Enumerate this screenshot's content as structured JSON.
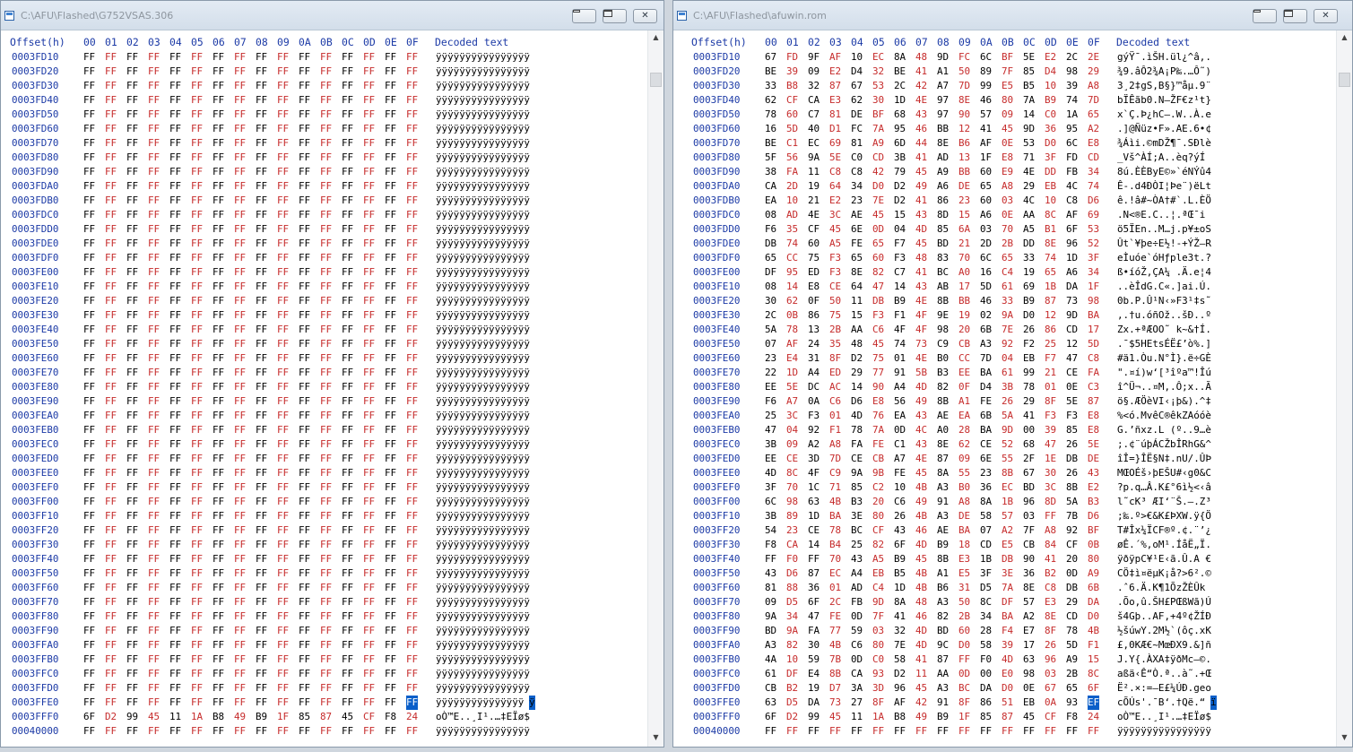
{
  "left": {
    "title": "C:\\AFU\\Flashed\\G752VSAS.306",
    "header": {
      "offset": "Offset(h)",
      "cols": [
        "00",
        "01",
        "02",
        "03",
        "04",
        "05",
        "06",
        "07",
        "08",
        "09",
        "0A",
        "0B",
        "0C",
        "0D",
        "0E",
        "0F"
      ],
      "decoded": "Decoded text"
    },
    "rows": [
      {
        "o": "0003FD10",
        "b": "FF FF FF FF FF FF FF FF FF FF FF FF FF FF FF FF",
        "d": "ÿÿÿÿÿÿÿÿÿÿÿÿÿÿÿÿ"
      },
      {
        "o": "0003FD20",
        "b": "FF FF FF FF FF FF FF FF FF FF FF FF FF FF FF FF",
        "d": "ÿÿÿÿÿÿÿÿÿÿÿÿÿÿÿÿ"
      },
      {
        "o": "0003FD30",
        "b": "FF FF FF FF FF FF FF FF FF FF FF FF FF FF FF FF",
        "d": "ÿÿÿÿÿÿÿÿÿÿÿÿÿÿÿÿ"
      },
      {
        "o": "0003FD40",
        "b": "FF FF FF FF FF FF FF FF FF FF FF FF FF FF FF FF",
        "d": "ÿÿÿÿÿÿÿÿÿÿÿÿÿÿÿÿ"
      },
      {
        "o": "0003FD50",
        "b": "FF FF FF FF FF FF FF FF FF FF FF FF FF FF FF FF",
        "d": "ÿÿÿÿÿÿÿÿÿÿÿÿÿÿÿÿ"
      },
      {
        "o": "0003FD60",
        "b": "FF FF FF FF FF FF FF FF FF FF FF FF FF FF FF FF",
        "d": "ÿÿÿÿÿÿÿÿÿÿÿÿÿÿÿÿ"
      },
      {
        "o": "0003FD70",
        "b": "FF FF FF FF FF FF FF FF FF FF FF FF FF FF FF FF",
        "d": "ÿÿÿÿÿÿÿÿÿÿÿÿÿÿÿÿ"
      },
      {
        "o": "0003FD80",
        "b": "FF FF FF FF FF FF FF FF FF FF FF FF FF FF FF FF",
        "d": "ÿÿÿÿÿÿÿÿÿÿÿÿÿÿÿÿ"
      },
      {
        "o": "0003FD90",
        "b": "FF FF FF FF FF FF FF FF FF FF FF FF FF FF FF FF",
        "d": "ÿÿÿÿÿÿÿÿÿÿÿÿÿÿÿÿ"
      },
      {
        "o": "0003FDA0",
        "b": "FF FF FF FF FF FF FF FF FF FF FF FF FF FF FF FF",
        "d": "ÿÿÿÿÿÿÿÿÿÿÿÿÿÿÿÿ"
      },
      {
        "o": "0003FDB0",
        "b": "FF FF FF FF FF FF FF FF FF FF FF FF FF FF FF FF",
        "d": "ÿÿÿÿÿÿÿÿÿÿÿÿÿÿÿÿ"
      },
      {
        "o": "0003FDC0",
        "b": "FF FF FF FF FF FF FF FF FF FF FF FF FF FF FF FF",
        "d": "ÿÿÿÿÿÿÿÿÿÿÿÿÿÿÿÿ"
      },
      {
        "o": "0003FDD0",
        "b": "FF FF FF FF FF FF FF FF FF FF FF FF FF FF FF FF",
        "d": "ÿÿÿÿÿÿÿÿÿÿÿÿÿÿÿÿ"
      },
      {
        "o": "0003FDE0",
        "b": "FF FF FF FF FF FF FF FF FF FF FF FF FF FF FF FF",
        "d": "ÿÿÿÿÿÿÿÿÿÿÿÿÿÿÿÿ"
      },
      {
        "o": "0003FDF0",
        "b": "FF FF FF FF FF FF FF FF FF FF FF FF FF FF FF FF",
        "d": "ÿÿÿÿÿÿÿÿÿÿÿÿÿÿÿÿ"
      },
      {
        "o": "0003FE00",
        "b": "FF FF FF FF FF FF FF FF FF FF FF FF FF FF FF FF",
        "d": "ÿÿÿÿÿÿÿÿÿÿÿÿÿÿÿÿ"
      },
      {
        "o": "0003FE10",
        "b": "FF FF FF FF FF FF FF FF FF FF FF FF FF FF FF FF",
        "d": "ÿÿÿÿÿÿÿÿÿÿÿÿÿÿÿÿ"
      },
      {
        "o": "0003FE20",
        "b": "FF FF FF FF FF FF FF FF FF FF FF FF FF FF FF FF",
        "d": "ÿÿÿÿÿÿÿÿÿÿÿÿÿÿÿÿ"
      },
      {
        "o": "0003FE30",
        "b": "FF FF FF FF FF FF FF FF FF FF FF FF FF FF FF FF",
        "d": "ÿÿÿÿÿÿÿÿÿÿÿÿÿÿÿÿ"
      },
      {
        "o": "0003FE40",
        "b": "FF FF FF FF FF FF FF FF FF FF FF FF FF FF FF FF",
        "d": "ÿÿÿÿÿÿÿÿÿÿÿÿÿÿÿÿ"
      },
      {
        "o": "0003FE50",
        "b": "FF FF FF FF FF FF FF FF FF FF FF FF FF FF FF FF",
        "d": "ÿÿÿÿÿÿÿÿÿÿÿÿÿÿÿÿ"
      },
      {
        "o": "0003FE60",
        "b": "FF FF FF FF FF FF FF FF FF FF FF FF FF FF FF FF",
        "d": "ÿÿÿÿÿÿÿÿÿÿÿÿÿÿÿÿ"
      },
      {
        "o": "0003FE70",
        "b": "FF FF FF FF FF FF FF FF FF FF FF FF FF FF FF FF",
        "d": "ÿÿÿÿÿÿÿÿÿÿÿÿÿÿÿÿ"
      },
      {
        "o": "0003FE80",
        "b": "FF FF FF FF FF FF FF FF FF FF FF FF FF FF FF FF",
        "d": "ÿÿÿÿÿÿÿÿÿÿÿÿÿÿÿÿ"
      },
      {
        "o": "0003FE90",
        "b": "FF FF FF FF FF FF FF FF FF FF FF FF FF FF FF FF",
        "d": "ÿÿÿÿÿÿÿÿÿÿÿÿÿÿÿÿ"
      },
      {
        "o": "0003FEA0",
        "b": "FF FF FF FF FF FF FF FF FF FF FF FF FF FF FF FF",
        "d": "ÿÿÿÿÿÿÿÿÿÿÿÿÿÿÿÿ"
      },
      {
        "o": "0003FEB0",
        "b": "FF FF FF FF FF FF FF FF FF FF FF FF FF FF FF FF",
        "d": "ÿÿÿÿÿÿÿÿÿÿÿÿÿÿÿÿ"
      },
      {
        "o": "0003FEC0",
        "b": "FF FF FF FF FF FF FF FF FF FF FF FF FF FF FF FF",
        "d": "ÿÿÿÿÿÿÿÿÿÿÿÿÿÿÿÿ"
      },
      {
        "o": "0003FED0",
        "b": "FF FF FF FF FF FF FF FF FF FF FF FF FF FF FF FF",
        "d": "ÿÿÿÿÿÿÿÿÿÿÿÿÿÿÿÿ"
      },
      {
        "o": "0003FEE0",
        "b": "FF FF FF FF FF FF FF FF FF FF FF FF FF FF FF FF",
        "d": "ÿÿÿÿÿÿÿÿÿÿÿÿÿÿÿÿ"
      },
      {
        "o": "0003FEF0",
        "b": "FF FF FF FF FF FF FF FF FF FF FF FF FF FF FF FF",
        "d": "ÿÿÿÿÿÿÿÿÿÿÿÿÿÿÿÿ"
      },
      {
        "o": "0003FF00",
        "b": "FF FF FF FF FF FF FF FF FF FF FF FF FF FF FF FF",
        "d": "ÿÿÿÿÿÿÿÿÿÿÿÿÿÿÿÿ"
      },
      {
        "o": "0003FF10",
        "b": "FF FF FF FF FF FF FF FF FF FF FF FF FF FF FF FF",
        "d": "ÿÿÿÿÿÿÿÿÿÿÿÿÿÿÿÿ"
      },
      {
        "o": "0003FF20",
        "b": "FF FF FF FF FF FF FF FF FF FF FF FF FF FF FF FF",
        "d": "ÿÿÿÿÿÿÿÿÿÿÿÿÿÿÿÿ"
      },
      {
        "o": "0003FF30",
        "b": "FF FF FF FF FF FF FF FF FF FF FF FF FF FF FF FF",
        "d": "ÿÿÿÿÿÿÿÿÿÿÿÿÿÿÿÿ"
      },
      {
        "o": "0003FF40",
        "b": "FF FF FF FF FF FF FF FF FF FF FF FF FF FF FF FF",
        "d": "ÿÿÿÿÿÿÿÿÿÿÿÿÿÿÿÿ"
      },
      {
        "o": "0003FF50",
        "b": "FF FF FF FF FF FF FF FF FF FF FF FF FF FF FF FF",
        "d": "ÿÿÿÿÿÿÿÿÿÿÿÿÿÿÿÿ"
      },
      {
        "o": "0003FF60",
        "b": "FF FF FF FF FF FF FF FF FF FF FF FF FF FF FF FF",
        "d": "ÿÿÿÿÿÿÿÿÿÿÿÿÿÿÿÿ"
      },
      {
        "o": "0003FF70",
        "b": "FF FF FF FF FF FF FF FF FF FF FF FF FF FF FF FF",
        "d": "ÿÿÿÿÿÿÿÿÿÿÿÿÿÿÿÿ"
      },
      {
        "o": "0003FF80",
        "b": "FF FF FF FF FF FF FF FF FF FF FF FF FF FF FF FF",
        "d": "ÿÿÿÿÿÿÿÿÿÿÿÿÿÿÿÿ"
      },
      {
        "o": "0003FF90",
        "b": "FF FF FF FF FF FF FF FF FF FF FF FF FF FF FF FF",
        "d": "ÿÿÿÿÿÿÿÿÿÿÿÿÿÿÿÿ"
      },
      {
        "o": "0003FFA0",
        "b": "FF FF FF FF FF FF FF FF FF FF FF FF FF FF FF FF",
        "d": "ÿÿÿÿÿÿÿÿÿÿÿÿÿÿÿÿ"
      },
      {
        "o": "0003FFB0",
        "b": "FF FF FF FF FF FF FF FF FF FF FF FF FF FF FF FF",
        "d": "ÿÿÿÿÿÿÿÿÿÿÿÿÿÿÿÿ"
      },
      {
        "o": "0003FFC0",
        "b": "FF FF FF FF FF FF FF FF FF FF FF FF FF FF FF FF",
        "d": "ÿÿÿÿÿÿÿÿÿÿÿÿÿÿÿÿ"
      },
      {
        "o": "0003FFD0",
        "b": "FF FF FF FF FF FF FF FF FF FF FF FF FF FF FF FF",
        "d": "ÿÿÿÿÿÿÿÿÿÿÿÿÿÿÿÿ"
      },
      {
        "o": "0003FFE0",
        "b": "FF FF FF FF FF FF FF FF FF FF FF FF FF FF FF FF",
        "d": "ÿÿÿÿÿÿÿÿÿÿÿÿÿÿÿ",
        "ds": "ÿ",
        "sel": 15
      },
      {
        "o": "0003FFF0",
        "b": "6F D2 99 45 11 1A B8 49 B9 1F 85 87 45 CF F8 24",
        "d": "oÒ™E..¸I¹.…‡EÏø$"
      },
      {
        "o": "00040000",
        "b": "FF FF FF FF FF FF FF FF FF FF FF FF FF FF FF FF",
        "d": "ÿÿÿÿÿÿÿÿÿÿÿÿÿÿÿÿ"
      }
    ]
  },
  "right": {
    "title": "C:\\AFU\\Flashed\\afuwin.rom",
    "header": {
      "offset": "Offset(h)",
      "cols": [
        "00",
        "01",
        "02",
        "03",
        "04",
        "05",
        "06",
        "07",
        "08",
        "09",
        "0A",
        "0B",
        "0C",
        "0D",
        "0E",
        "0F"
      ],
      "decoded": "Decoded text"
    },
    "rows": [
      {
        "o": "0003FD10",
        "b": "67 FD 9F AF 10 EC 8A 48 9D FC 6C BF 5E E2 2C 2E",
        "d": "gýŸ¯.ìŠH.ül¿^â,."
      },
      {
        "o": "0003FD20",
        "b": "BE 39 09 E2 D4 32 BE 41 A1 50 89 7F 85 D4 98 29",
        "d": "¾9.âÔ2¾A¡P‰.…Ô˜)"
      },
      {
        "o": "0003FD30",
        "b": "33 B8 32 87 67 53 2C 42 A7 7D 99 E5 B5 10 39 A8",
        "d": "3¸2‡gS,B§}™åµ.9¨"
      },
      {
        "o": "0003FD40",
        "b": "62 CF CA E3 62 30 1D 4E 97 8E 46 80 7A B9 74 7D",
        "d": "bÏÊãb0.N—ŽF€z¹t}"
      },
      {
        "o": "0003FD50",
        "b": "78 60 C7 81 DE BF 68 43 97 90 57 09 14 C0 1A 65",
        "d": "x`Ç.Þ¿hC—.W..À.e"
      },
      {
        "o": "0003FD60",
        "b": "16 5D 40 D1 FC 7A 95 46 BB 12 41 45 9D 36 95 A2",
        "d": ".]@Ñüz•F».AE.6•¢"
      },
      {
        "o": "0003FD70",
        "b": "BE C1 EC 69 81 A9 6D 44 8E B6 AF 0E 53 D0 6C E8",
        "d": "¾Áìi.©mDŽ¶¯.SÐlè"
      },
      {
        "o": "0003FD80",
        "b": "5F 56 9A 5E C0 CD 3B 41 AD 13 1F E8 71 3F FD CD",
        "d": "_Vš^ÀÍ;A­..èq?ýÍ"
      },
      {
        "o": "0003FD90",
        "b": "38 FA 11 C8 C8 42 79 45 A9 BB 60 E9 4E DD FB 34",
        "d": "8ú.ÈÈByE©»`éNÝû4"
      },
      {
        "o": "0003FDA0",
        "b": "CA 2D 19 64 34 D0 D2 49 A6 DE 65 A8 29 EB 4C 74",
        "d": "Ê-.d4ÐÒI¦Þe¨)ëLt"
      },
      {
        "o": "0003FDB0",
        "b": "EA 10 21 E2 23 7E D2 41 86 23 60 03 4C 10 C8 D6",
        "d": "ê.!â#~ÒA†#`.L.ÈÖ"
      },
      {
        "o": "0003FDC0",
        "b": "08 AD 4E 3C AE 45 15 43 8D 15 A6 0E AA 8C AF 69",
        "d": ".­N<®E.C..¦.ªŒ¯i"
      },
      {
        "o": "0003FDD0",
        "b": "F6 35 CF 45 6E 0D 04 4D 85 6A 03 70 A5 B1 6F 53",
        "d": "ö5ÏEn..M…j.p¥±oS"
      },
      {
        "o": "0003FDE0",
        "b": "DB 74 60 A5 FE 65 F7 45 BD 21 2D 2B DD 8E 96 52",
        "d": "Ût`¥þe÷E½!-+ÝŽ–R"
      },
      {
        "o": "0003FDF0",
        "b": "65 CC 75 F3 65 60 F3 48 83 70 6C 65 33 74 1D 3F",
        "d": "eÌuóe`óHƒple3t.?"
      },
      {
        "o": "0003FE00",
        "b": "DF 95 ED F3 8E 82 C7 41 BC A0 16 C4 19 65 A6 34",
        "d": "ß•íóŽ‚ÇA¼ .Ä.e¦4"
      },
      {
        "o": "0003FE10",
        "b": "08 14 E8 CE 64 47 14 43 AB 17 5D 61 69 1B DA 1F",
        "d": "..èÎdG.C«.]ai.Ú."
      },
      {
        "o": "0003FE20",
        "b": "30 62 0F 50 11 DB B9 4E 8B BB 46 33 B9 87 73 98",
        "d": "0b.P.Û¹N‹»F3¹‡s˜"
      },
      {
        "o": "0003FE30",
        "b": "2C 0B 86 75 15 F3 F1 4F 9E 19 02 9A D0 12 9D BA",
        "d": ",.†u.óñOž..šÐ..º"
      },
      {
        "o": "0003FE40",
        "b": "5A 78 13 2B AA C6 4F 4F 98 20 6B 7E 26 86 CD 17",
        "d": "Zx.+ªÆOO˜ k~&†Í."
      },
      {
        "o": "0003FE50",
        "b": "07 AF 24 35 48 45 74 73 C9 CB A3 92 F2 25 12 5D",
        "d": ".¯$5HEtsÉË£’ò%.]"
      },
      {
        "o": "0003FE60",
        "b": "23 E4 31 8F D2 75 01 4E B0 CC 7D 04 EB F7 47 C8",
        "d": "#ä1.Òu.N°Ì}.ë÷GÈ"
      },
      {
        "o": "0003FE70",
        "b": "22 1D A4 ED 29 77 91 5B B3 EE BA 61 99 21 CE FA",
        "d": "\".¤í)w‘[³îºa™!Îú"
      },
      {
        "o": "0003FE80",
        "b": "EE 5E DC AC 14 90 A4 4D 82 0F D4 3B 78 01 0E C3",
        "d": "î^Ü¬..¤M‚.Ô;x..Ã"
      },
      {
        "o": "0003FE90",
        "b": "F6 A7 0A C6 D6 E8 56 49 8B A1 FE 26 29 8F 5E 87",
        "d": "ö§.ÆÖèVI‹¡þ&).^‡"
      },
      {
        "o": "0003FEA0",
        "b": "25 3C F3 01 4D 76 EA 43 AE EA 6B 5A 41 F3 F3 E8",
        "d": "%<ó.MvêC®êkZAóóè"
      },
      {
        "o": "0003FEB0",
        "b": "47 04 92 F1 78 7A 0D 4C A0 28 BA 9D 00 39 85 E8",
        "d": "G.’ñxz.L (º..9…è"
      },
      {
        "o": "0003FEC0",
        "b": "3B 09 A2 A8 FA FE C1 43 8E 62 CE 52 68 47 26 5E",
        "d": ";.¢¨úþÁCŽbÎRhG&^"
      },
      {
        "o": "0003FED0",
        "b": "EE CE 3D 7D CE CB A7 4E 87 09 6E 55 2F 1E DB DE",
        "d": "îÎ=}ÎË§N‡.nU/.ÛÞ"
      },
      {
        "o": "0003FEE0",
        "b": "4D 8C 4F C9 9A 9B FE 45 8A 55 23 8B 67 30 26 43",
        "d": "MŒOÉš›þEŠU#‹g0&C"
      },
      {
        "o": "0003FEF0",
        "b": "3F 70 1C 71 85 C2 10 4B A3 B0 36 EC BD 3C 8B E2",
        "d": "?p.q…Â.K£°6ì½<‹â"
      },
      {
        "o": "0003FF00",
        "b": "6C 98 63 4B B3 20 C6 49 91 A8 8A 1B 96 8D 5A B3",
        "d": "l˜cK³ ÆI‘¨Š.–.Z³"
      },
      {
        "o": "0003FF10",
        "b": "3B 89 1D BA 3E 80 26 4B A3 DE 58 57 03 FF 7B D6",
        "d": ";‰.º>€&K£ÞXW.ÿ{Ö"
      },
      {
        "o": "0003FF20",
        "b": "54 23 CE 78 BC CF 43 46 AE BA 07 A2 7F A8 92 BF",
        "d": "T#Îx¼ÏCF®º.¢.¨’¿"
      },
      {
        "o": "0003FF30",
        "b": "F8 CA 14 B4 25 82 6F 4D B9 18 CD E5 CB 84 CF 0B",
        "d": "øÊ.´%‚oM¹.ÍåË„Ï."
      },
      {
        "o": "0003FF40",
        "b": "FF F0 FF 70 43 A5 B9 45 8B E3 1B DB 90 41 20 80",
        "d": "ÿðÿpC¥¹E‹ã.Û.A €"
      },
      {
        "o": "0003FF50",
        "b": "43 D6 87 EC A4 EB B5 4B A1 E5 3F 3E 36 B2 0D A9",
        "d": "CÖ‡ì¤ëµK¡å?>6².©"
      },
      {
        "o": "0003FF60",
        "b": "81 88 36 01 AD C4 1D 4B B6 31 D5 7A 8E C8 DB 6B",
        "d": ".ˆ6.­Ä.K¶1ÕzŽÈÛk"
      },
      {
        "o": "0003FF70",
        "b": "09 D5 6F 2C FB 9D 8A 48 A3 50 8C DF 57 E3 29 DA",
        "d": ".Õo,û.ŠH£PŒßWã)Ú"
      },
      {
        "o": "0003FF80",
        "b": "9A 34 47 FE 0D 7F 41 46 82 2B 34 BA A2 8E CD D0",
        "d": "š4Gþ..AF‚+4º¢ŽÍÐ"
      },
      {
        "o": "0003FF90",
        "b": "BD 9A FA 77 59 03 32 4D BD 60 28 F4 E7 8F 78 4B",
        "d": "½šúwY.2M½`(ôç.xK"
      },
      {
        "o": "0003FFA0",
        "b": "A3 82 30 4B C6 80 7E 4D 9C D0 58 39 17 26 5D F1",
        "d": "£‚0KÆ€~MœÐX9.&]ñ"
      },
      {
        "o": "0003FFB0",
        "b": "4A 10 59 7B 0D C0 58 41 87 FF F0 4D 63 96 A9 15",
        "d": "J.Y{.ÀXA‡ÿðMc–©."
      },
      {
        "o": "0003FFC0",
        "b": "61 DF E4 8B CA 93 D2 11 AA 0D 00 E0 98 03 2B 8C",
        "d": "aßä‹Ê“Ò.ª..à˜.+Œ"
      },
      {
        "o": "0003FFD0",
        "b": "CB B2 19 D7 3A 3D 96 45 A3 BC DA D0 0E 67 65 6F",
        "d": "Ë².×:=–E£¼ÚÐ.geo"
      },
      {
        "o": "0003FFE0",
        "b": "63 D5 DA 73 27 8F AF 42 91 8F 86 51 EB 0A 93 EF",
        "d": "cÕÚs'.¯B‘.†Që.“",
        "ds": "ï",
        "sel": 15
      },
      {
        "o": "0003FFF0",
        "b": "6F D2 99 45 11 1A B8 49 B9 1F 85 87 45 CF F8 24",
        "d": "oÒ™E..¸I¹.…‡EÏø$"
      },
      {
        "o": "00040000",
        "b": "FF FF FF FF FF FF FF FF FF FF FF FF FF FF FF FF",
        "d": "ÿÿÿÿÿÿÿÿÿÿÿÿÿÿÿÿ"
      }
    ]
  },
  "window_buttons": {
    "minimize": "–",
    "maximize": "□",
    "close": "✕"
  },
  "scrollbar": {
    "up": "▲",
    "down": "▼"
  },
  "colors": {
    "offset_blue": "#1c3aa6",
    "alt_byte_red": "#c62b2b",
    "selection": "#0a5fc9"
  },
  "icons": [
    "app-icon",
    "minimize-icon",
    "maximize-icon",
    "close-icon",
    "scroll-up-icon",
    "scroll-down-icon"
  ]
}
